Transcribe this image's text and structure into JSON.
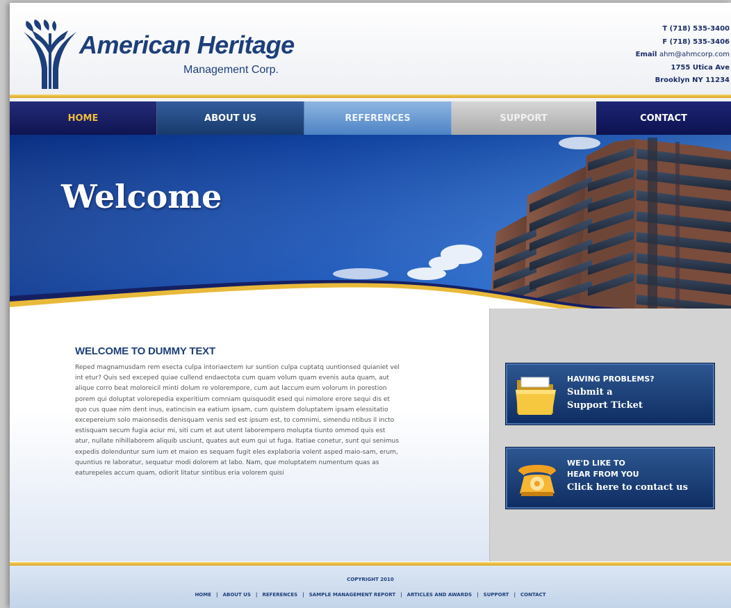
{
  "brand": {
    "name": "American Heritage",
    "subtitle": "Management Corp."
  },
  "contact": {
    "phone": "T (718) 535-3400",
    "fax": "F (718) 535-3406",
    "email_label": "Email",
    "email": "ahm@ahmcorp.com",
    "street": "1755 Utica Ave",
    "city": "Brooklyn NY 11234"
  },
  "nav": {
    "home": "HOME",
    "about": "ABOUT US",
    "references": "REFERENCES",
    "support": "SUPPORT",
    "contact": "CONTACT"
  },
  "banner": {
    "title": "Welcome"
  },
  "content": {
    "title": "WELCOME TO DUMMY TEXT",
    "body": "Reped magnamusdam rem esecta culpa intoriaectem iur suntion culpa cuptatq uuntionsed quianiet vel int etur? Quis sed exceped quiae cullend endaectota cum quam volum quam evenis auta quam, aut alique corro beat moloreicil minti dolum re volorempore, cum aut laccum eum volorum in porestion porem qui doluptat volorepedia experitium comniam quisquodit esed qui nimolore erore sequi dis et quo cus quae nim dent inus, eatincisin ea eatium ipsam, cum quistem doluptatem ipsam elessitatio excepereium solo maionsedis denisquam venis sed est ipsum est, to comnimi, simendu ntibus il incto estisquam secum fugia aciur mi, siti cum et aut utent laborempero molupta tiunto ommod quis est atur, nullate nihillaborem aliquib usciunt, quates aut eum qui ut fuga. Itatiae conetur, sunt qui senimus expedis dolenduntur sum ium et maion es sequam fugit eles explaboria volent asped maio-sam, erum, quuntius re laboratur, sequatur modi dolorem at labo. Nam, que moluptatem numentum quas as eaturepeles accum quam, odiorit litatur sintibus eria volorem quisi"
  },
  "promos": {
    "support": {
      "line1": "HAVING PROBLEMS?",
      "line2": "Submit a",
      "line3": "Support Ticket"
    },
    "contact": {
      "line1": "WE'D LIKE TO",
      "line2": "HEAR FROM YOU",
      "line3": "Click here to contact us"
    }
  },
  "footer": {
    "copyright": "COPYRIGHT 2010",
    "links": {
      "home": "HOME",
      "about": "ABOUT US",
      "references": "REFERENCES",
      "report": "SAMPLE MANAGEMENT REPORT",
      "articles": "ARTICLES AND AWARDS",
      "support": "SUPPORT",
      "contact": "CONTACT"
    }
  },
  "colors": {
    "brand_blue": "#1d3f7a",
    "gold": "#e8b93a",
    "nav_home_text": "#f0bd3e"
  }
}
